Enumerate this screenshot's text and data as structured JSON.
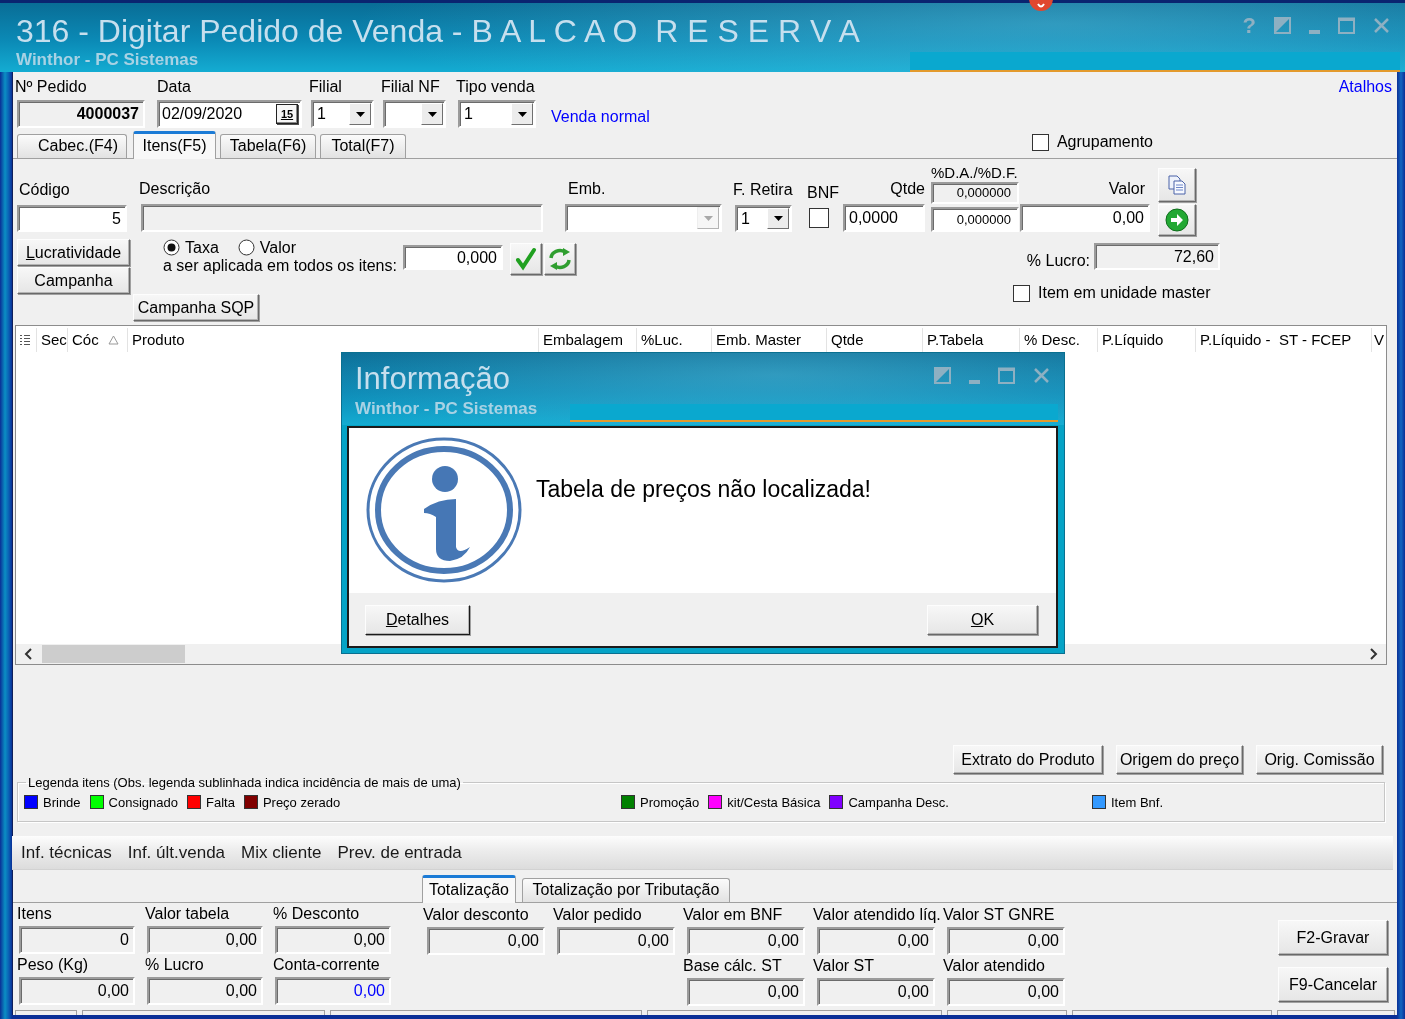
{
  "window": {
    "title": "316 - Digitar Pedido de Venda - B A L C A O  R E S E R V A",
    "subtitle": "Winthor - PC Sistemas",
    "help": "?"
  },
  "header": {
    "fields": [
      {
        "kind": "order",
        "label": "Nº Pedido",
        "value": "4000037",
        "readonly": true
      },
      {
        "kind": "date",
        "label": "Data",
        "value": "02/09/2020",
        "picker": "15"
      },
      {
        "kind": "combo",
        "label": "Filial",
        "value": "1"
      },
      {
        "kind": "combo",
        "label": "Filial NF"
      },
      {
        "kind": "combo",
        "label": "Tipo venda",
        "value": "1"
      }
    ],
    "sale_type_name": "Venda normal",
    "shortcuts": "Atalhos"
  },
  "tabs": [
    {
      "label": "Cabec.(F4)",
      "selected": false
    },
    {
      "label": "Itens(F5)",
      "selected": true
    },
    {
      "label": "Tabela(F6)",
      "selected": false
    },
    {
      "label": "Total(F7)",
      "selected": false
    }
  ],
  "grouping": {
    "label": "Agrupamento",
    "checked": false
  },
  "item": {
    "code": {
      "label": "Código",
      "value": "5"
    },
    "description": {
      "label": "Descrição",
      "readonly": true
    },
    "packaging": {
      "label": "Emb.",
      "disabled": true
    },
    "pickup": {
      "label": "F. Retira",
      "value": "1"
    },
    "bnf": {
      "label": "BNF",
      "checked": false
    },
    "quantity": {
      "label": "Qtde",
      "value": "0,0000"
    },
    "discounts": {
      "label": "%D.A./%D.F.",
      "fields": [
        {
          "value": "0,000000",
          "readonly": true
        },
        {
          "value": "0,000000"
        }
      ]
    },
    "price": {
      "label": "Valor",
      "value": "0,00"
    },
    "side_buttons": [
      {
        "label": "Lucratividade",
        "accelerator": true
      },
      {
        "label": "Campanha"
      }
    ],
    "rate_modes": [
      {
        "label": "Taxa",
        "selected": true
      },
      {
        "label": "Valor",
        "selected": false
      }
    ],
    "apply_label": "a ser aplicada em todos os itens:",
    "apply_value": "0,000",
    "campaign_sqp": "Campanha SQP",
    "profit": {
      "label": "% Lucro:",
      "value": "72,60",
      "readonly": true
    },
    "master_unit": {
      "label": "Item em unidade master",
      "checked": false
    }
  },
  "grid": {
    "columns": [
      {
        "label": "Sec"
      },
      {
        "label": "Cóc",
        "sorted_ascending": true
      },
      {
        "label": "Produto"
      },
      {
        "label": "Embalagem"
      },
      {
        "label": "%Luc."
      },
      {
        "label": "Emb. Master"
      },
      {
        "label": "Qtde"
      },
      {
        "label": "P.Tabela"
      },
      {
        "label": "% Desc."
      },
      {
        "label": "P.Líquido"
      },
      {
        "label": "P.Líquido -  ST - FCEP"
      },
      {
        "label": "V"
      }
    ]
  },
  "dialog": {
    "title": "Informação",
    "subtitle": "Winthor - PC Sistemas",
    "message": "Tabela de preços não localizada!",
    "buttons": [
      {
        "label": "Detalhes",
        "accelerator": true
      },
      {
        "label": "OK",
        "accelerator": true
      }
    ]
  },
  "item_actions": [
    "Extrato do Produto",
    "Origem do preço",
    "Orig. Comissão"
  ],
  "legend": {
    "title": "Legenda itens (Obs. legenda sublinhada indica incidência de mais de uma)",
    "groups": [
      [
        {
          "label": "Brinde",
          "color": "#0000ff"
        },
        {
          "label": "Consignado",
          "color": "#00ff00"
        },
        {
          "label": "Falta",
          "color": "#ff0000"
        },
        {
          "label": "Preço zerado",
          "color": "#800000"
        }
      ],
      [
        {
          "label": "Promoção",
          "color": "#008000"
        },
        {
          "label": "kit/Cesta Básica",
          "color": "#ff00ff"
        },
        {
          "label": "Campanha Desc.",
          "color": "#8000ff"
        }
      ],
      [
        {
          "label": "Item Bnf.",
          "color": "#3399ff"
        }
      ]
    ]
  },
  "info_tabs": [
    "Inf. técnicas",
    "Inf. últ.venda",
    "Mix cliente",
    "Prev. de entrada"
  ],
  "totals_tabs": [
    {
      "label": "Totalização",
      "selected": true
    },
    {
      "label": "Totalização por Tributação",
      "selected": false
    }
  ],
  "totals": {
    "readonly": true,
    "left_columns": [
      [
        {
          "label": "Itens",
          "value": "0"
        },
        {
          "label": "Peso (Kg)",
          "value": "0,00"
        }
      ],
      [
        {
          "label": "Valor tabela",
          "value": "0,00"
        },
        {
          "label": "% Lucro",
          "value": "0,00"
        }
      ],
      [
        {
          "label": "% Desconto",
          "value": "0,00"
        },
        {
          "label": "Conta-corrente",
          "value": "0,00",
          "color": "#0000ff"
        }
      ]
    ],
    "right_columns": [
      [
        {
          "label": "Valor desconto",
          "value": "0,00"
        }
      ],
      [
        {
          "label": "Valor pedido",
          "value": "0,00"
        }
      ],
      [
        {
          "label": "Valor em BNF",
          "value": "0,00"
        },
        {
          "label": "Base cálc. ST",
          "value": "0,00"
        }
      ],
      [
        {
          "label": "Valor atendido líq.",
          "value": "0,00"
        },
        {
          "label": "Valor ST",
          "value": "0,00"
        }
      ],
      [
        {
          "label": "Valor ST GNRE",
          "value": "0,00"
        },
        {
          "label": "Valor atendido",
          "value": "0,00"
        }
      ]
    ]
  },
  "footer_buttons": [
    "F2-Gravar",
    "F9-Cancelar"
  ]
}
